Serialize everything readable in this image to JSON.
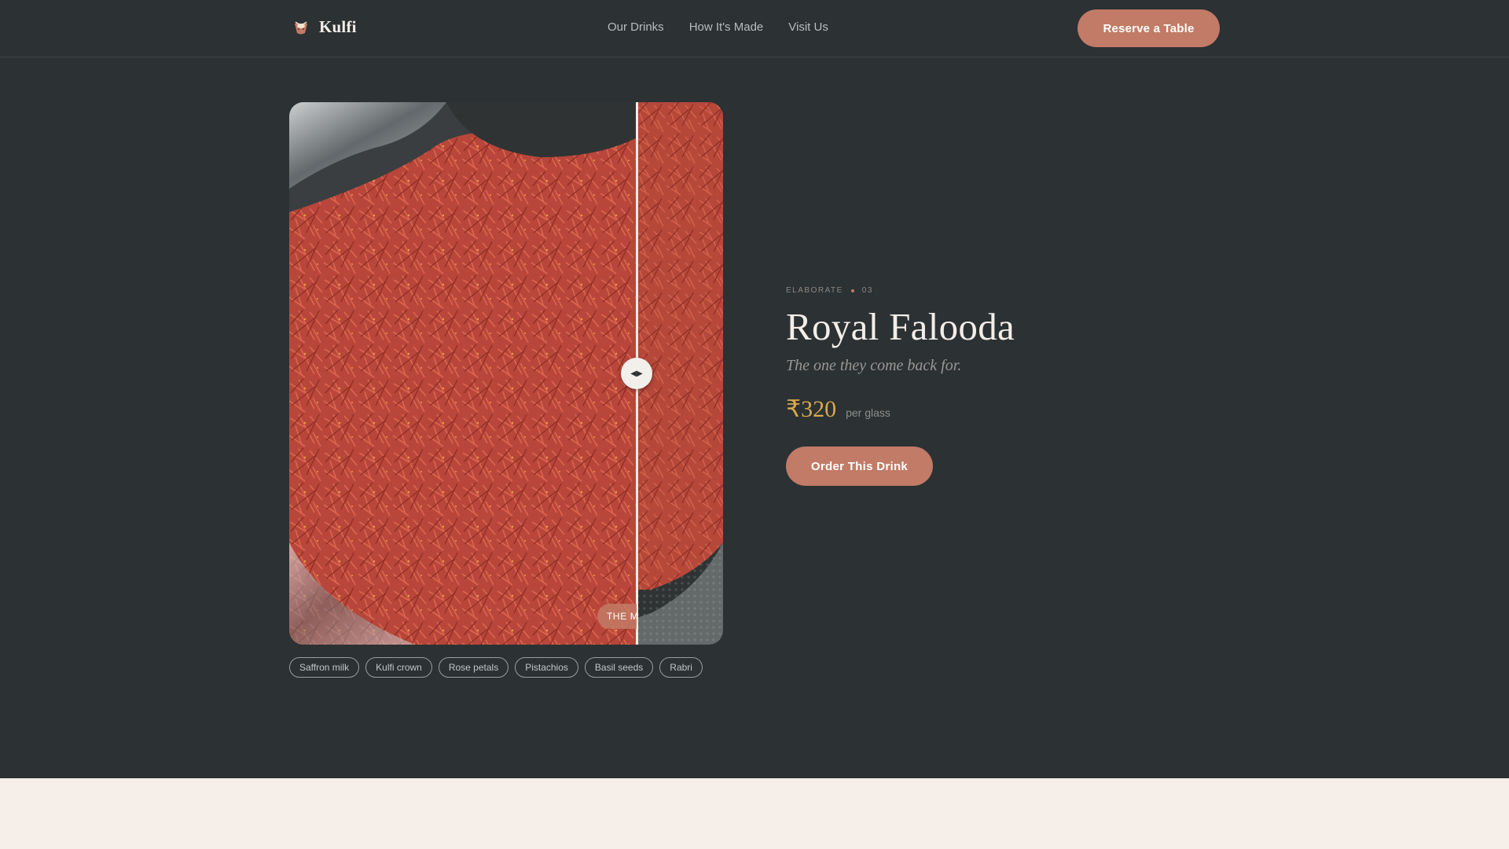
{
  "header": {
    "brand_name": "Kulfi",
    "brand_icon": "kulfi-cup-icon",
    "nav_links": [
      {
        "label": "Our Drinks"
      },
      {
        "label": "How It's Made"
      },
      {
        "label": "Visit Us"
      }
    ],
    "cta_label": "Reserve a Table"
  },
  "drink": {
    "category": "ELABORATE",
    "index": "03",
    "name": "Royal Falooda",
    "tagline": "The one they come back for.",
    "price": "₹320",
    "price_unit": "per glass",
    "order_label": "Order This Drink"
  },
  "media": {
    "compare_handle_icon": "left-right-arrows-icon",
    "label": "THE M",
    "slider_position_fraction": 0.8
  },
  "ingredients": [
    "Saffron milk",
    "Kulfi crown",
    "Rose petals",
    "Pistachios",
    "Basil seeds",
    "Rabri"
  ],
  "colors": {
    "background": "#2c3133",
    "accent": "#c27b66",
    "price": "#d9a94c",
    "band": "#f6eee8"
  }
}
